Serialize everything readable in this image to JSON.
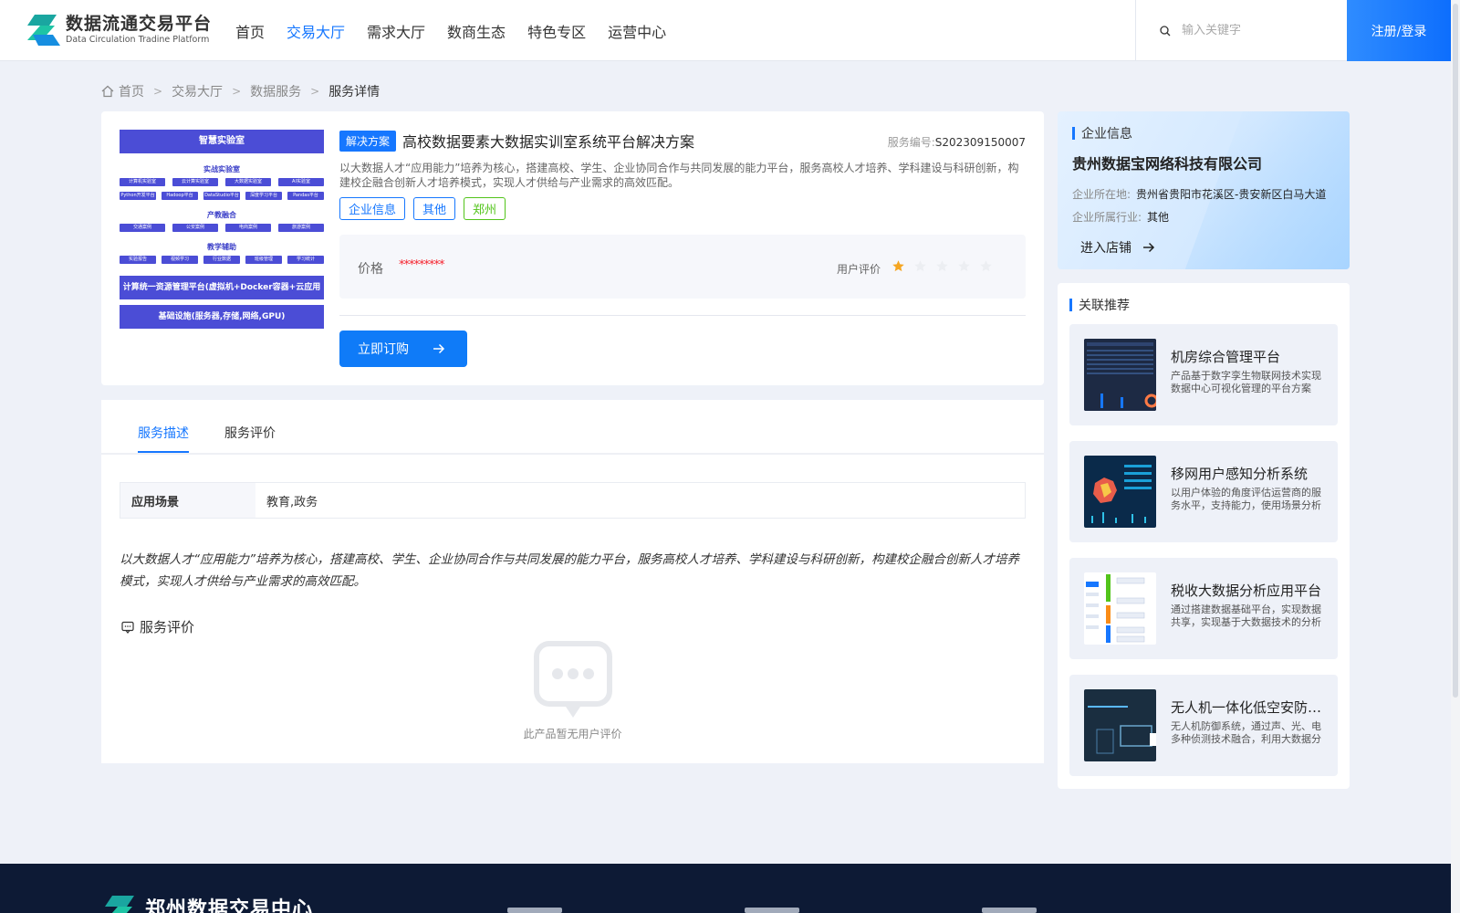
{
  "header": {
    "logo_title": "数据流通交易平台",
    "logo_subtitle": "Data Circulation Tradine Platform",
    "nav": [
      {
        "label": "首页",
        "active": false
      },
      {
        "label": "交易大厅",
        "active": true
      },
      {
        "label": "需求大厅",
        "active": false
      },
      {
        "label": "数商生态",
        "active": false
      },
      {
        "label": "特色专区",
        "active": false
      },
      {
        "label": "运营中心",
        "active": false
      }
    ],
    "search_placeholder": "输入关键字",
    "login_label": "注册/登录"
  },
  "breadcrumb": [
    "首页",
    "交易大厅",
    "数据服务",
    "服务详情"
  ],
  "product": {
    "image": {
      "top_bar": "智慧实验室",
      "sec1": "实战实验室",
      "row1": [
        "计算机实验室",
        "云计算实验室",
        "大数据实验室",
        "AI实验室"
      ],
      "row2": [
        "Python开发平台",
        "Hadoop平台",
        "DataStudio平台",
        "深度学习平台",
        "Pandas平台"
      ],
      "sec2": "产教融合",
      "row3": [
        "交通案例",
        "公安案例",
        "电商案例",
        "旅游案例"
      ],
      "sec3": "教学辅助",
      "row4": [
        "实验报告",
        "视频学习",
        "行业数据",
        "班级管理",
        "学习统计"
      ],
      "bar2": "计算统一资源管理平台(虚拟机+Docker容器+云应用",
      "bar3": "基础设施(服务器,存储,网络,GPU)"
    },
    "type_badge": "解决方案",
    "title": "高校数据要素大数据实训室系统平台解决方案",
    "service_no_label": "服务编号:",
    "service_no": "S202309150007",
    "description": "以大数据人才“应用能力”培养为核心，搭建高校、学生、企业协同合作与共同发展的能力平台，服务高校人才培养、学科建设与科研创新，构建校企融合创新人才培养模式，实现人才供给与产业需求的高效匹配。",
    "tags": [
      "企业信息",
      "其他",
      "郑州"
    ],
    "price_label": "价格",
    "price_value": "*********",
    "rating_label": "用户评价",
    "rating": 1,
    "rating_max": 5,
    "order_label": "立即订购"
  },
  "detail": {
    "tabs": [
      {
        "label": "服务描述",
        "active": true
      },
      {
        "label": "服务评价",
        "active": false
      }
    ],
    "scene_label": "应用场景",
    "scene_value": "教育,政务",
    "long_description": "以大数据人才“应用能力”培养为核心，搭建高校、学生、企业协同合作与共同发展的能力平台，服务高校人才培养、学科建设与科研创新，构建校企融合创新人才培养模式，实现人才供给与产业需求的高效匹配。",
    "review_title": "服务评价",
    "empty_text": "此产品暂无用户评价"
  },
  "company": {
    "section_title": "企业信息",
    "name": "贵州数据宝网络科技有限公司",
    "location_label": "企业所在地:",
    "location": "贵州省贵阳市花溪区-贵安新区白马大道",
    "industry_label": "企业所属行业:",
    "industry": "其他",
    "enter_shop": "进入店铺"
  },
  "related": {
    "section_title": "关联推荐",
    "items": [
      {
        "title": "机房综合管理平台",
        "desc": "产品基于数字孪生物联网技术实现数据中心可视化管理的平台方案"
      },
      {
        "title": "移网用户感知分析系统",
        "desc": "以用户体验的角度评估运营商的服务水平，支持能力，使用场景分析"
      },
      {
        "title": "税收大数据分析应用平台",
        "desc": "通过搭建数据基础平台，实现数据共享，实现基于大数据技术的分析应用"
      },
      {
        "title": "无人机一体化低空安防系统",
        "desc": "无人机防御系统，通过声、光、电多种侦测技术融合，利用大数据分析"
      }
    ]
  },
  "footer": {
    "title": "郑州数据交易中心"
  },
  "colors": {
    "primary": "#1677ff",
    "price": "#f5222d",
    "star": "#f5a623",
    "footer_bg": "#0d1a35"
  }
}
